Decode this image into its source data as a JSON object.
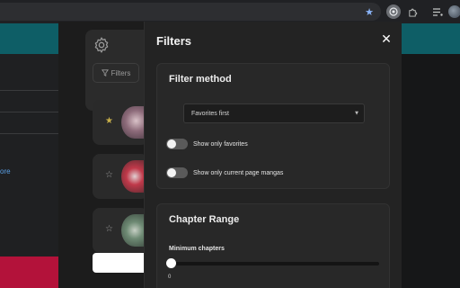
{
  "modal": {
    "title": "Filters",
    "filter_method": {
      "title": "Filter method",
      "select_value": "Favorites first",
      "toggles": [
        {
          "label": "Show only favorites",
          "on": false
        },
        {
          "label": "Show only current page mangas",
          "on": false
        }
      ]
    },
    "chapter_range": {
      "title": "Chapter Range",
      "min_label": "Minimum chapters",
      "min_value": "0",
      "slider_fraction": 0
    }
  },
  "popup": {
    "filters_button_label": "Filters",
    "manga_cards": [
      {
        "favorite": true
      },
      {
        "favorite": false
      },
      {
        "favorite": false
      }
    ]
  },
  "page": {
    "left_link_text": "ore"
  },
  "colors": {
    "star_favorite": "#c9b04a",
    "star_outline": "#9a9a9a",
    "teal": "#0e5e66",
    "red": "#b3123a"
  },
  "icons": {
    "bookmark_star": "star-icon",
    "extension": "puzzle-icon",
    "menu": "menu-icon",
    "settings": "gear-icon",
    "filter": "funnel-icon",
    "close": "close-icon"
  }
}
